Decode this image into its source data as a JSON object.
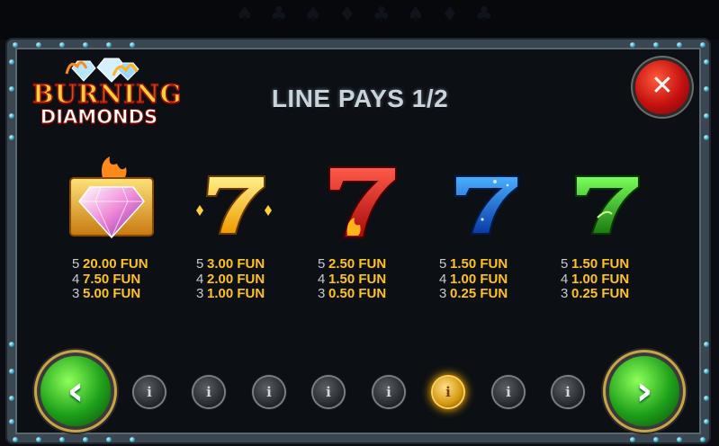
{
  "game": {
    "logo_line1": "BURNING",
    "logo_line2": "DIAMONDS"
  },
  "header": {
    "title": "LINE PAYS 1/2"
  },
  "close_button": {
    "glyph": "✕",
    "icon": "close-icon"
  },
  "paytable": [
    {
      "symbol": "burning-diamond",
      "pays": [
        {
          "count": "5",
          "value": "20.00 FUN"
        },
        {
          "count": "4",
          "value": "7.50 FUN"
        },
        {
          "count": "3",
          "value": "5.00 FUN"
        }
      ]
    },
    {
      "symbol": "gold-seven",
      "pays": [
        {
          "count": "5",
          "value": "3.00 FUN"
        },
        {
          "count": "4",
          "value": "2.00 FUN"
        },
        {
          "count": "3",
          "value": "1.00 FUN"
        }
      ]
    },
    {
      "symbol": "red-fire-seven",
      "pays": [
        {
          "count": "5",
          "value": "2.50 FUN"
        },
        {
          "count": "4",
          "value": "1.50 FUN"
        },
        {
          "count": "3",
          "value": "0.50 FUN"
        }
      ]
    },
    {
      "symbol": "blue-seven",
      "pays": [
        {
          "count": "5",
          "value": "1.50 FUN"
        },
        {
          "count": "4",
          "value": "1.00 FUN"
        },
        {
          "count": "3",
          "value": "0.25 FUN"
        }
      ]
    },
    {
      "symbol": "green-seven",
      "pays": [
        {
          "count": "5",
          "value": "1.50 FUN"
        },
        {
          "count": "4",
          "value": "1.00 FUN"
        },
        {
          "count": "3",
          "value": "0.25 FUN"
        }
      ]
    }
  ],
  "navigation": {
    "prev_glyph": "‹",
    "next_glyph": "›",
    "page_glyph": "i",
    "page_count": 8,
    "active_page": 6
  },
  "colors": {
    "payout_value": "#ffc21f",
    "title": "#c8d4dc",
    "nav_button": "#1ea01a",
    "close_button": "#c41010",
    "active_dot": "#ffb000"
  }
}
